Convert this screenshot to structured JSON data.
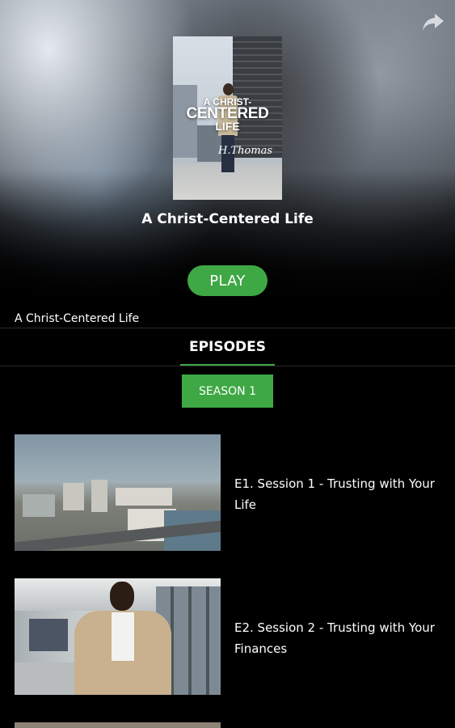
{
  "hero": {
    "title": "A Christ-Centered Life",
    "poster": {
      "line1": "A CHRIST-",
      "line2": "CENTERED",
      "line3": "LIFE",
      "signature": "H. Thomas"
    }
  },
  "actions": {
    "play_label": "PLAY"
  },
  "description": "A Christ-Centered Life",
  "tabs": [
    {
      "label": "EPISODES",
      "active": true
    }
  ],
  "season": {
    "label": "SEASON 1"
  },
  "episodes": [
    {
      "title": "E1. Session 1 - Trusting with Your Life"
    },
    {
      "title": "E2. Session 2 - Trusting with Your Finances"
    }
  ],
  "colors": {
    "accent": "#3ea844",
    "background": "#000000"
  },
  "icons": {
    "share": "share-icon"
  }
}
